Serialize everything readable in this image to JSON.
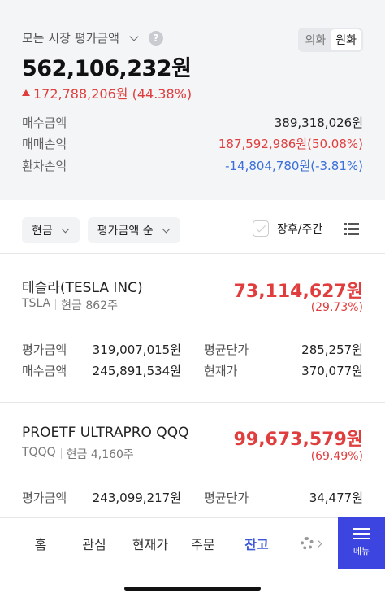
{
  "summary": {
    "market_label": "모든 시장 평가금액",
    "help_glyph": "?",
    "currency": {
      "foreign": "외화",
      "won": "원화"
    },
    "total": "562,106,232원",
    "change": "172,788,206원 (44.38%)",
    "rows": [
      {
        "label": "매수금액",
        "value": "389,318,026원"
      },
      {
        "label": "매매손익",
        "value": "187,592,986원(50.08%)"
      },
      {
        "label": "환차손익",
        "value": "-14,804,780원(-3.81%)"
      }
    ]
  },
  "filters": {
    "cash": "현금",
    "sort": "평가금액 순",
    "after_hours": "장후/주간"
  },
  "stocks": [
    {
      "name": "테슬라(TESLA INC)",
      "ticker": "TSLA",
      "holding": "현금 862주",
      "value": "73,114,627원",
      "rate": "(29.73%)",
      "kv": [
        {
          "k": "평가금액",
          "v": "319,007,015원"
        },
        {
          "k": "평균단가",
          "v": "285,257원"
        },
        {
          "k": "매수금액",
          "v": "245,891,534원"
        },
        {
          "k": "현재가",
          "v": "370,077원"
        }
      ]
    },
    {
      "name": "PROETF ULTRAPRO QQQ",
      "ticker": "TQQQ",
      "holding": "현금 4,160주",
      "value": "99,673,579원",
      "rate": "(69.49%)",
      "kv": [
        {
          "k": "평가금액",
          "v": "243,099,217원"
        },
        {
          "k": "평균단가",
          "v": "34,477원"
        }
      ]
    }
  ],
  "nav": {
    "tabs": [
      "홈",
      "관심",
      "현재가",
      "주문",
      "잔고"
    ],
    "active": "잔고",
    "menu": "메뉴"
  },
  "colors": {
    "up": "#e03e3e",
    "down": "#3b6fd9",
    "accent": "#3d45e0"
  }
}
